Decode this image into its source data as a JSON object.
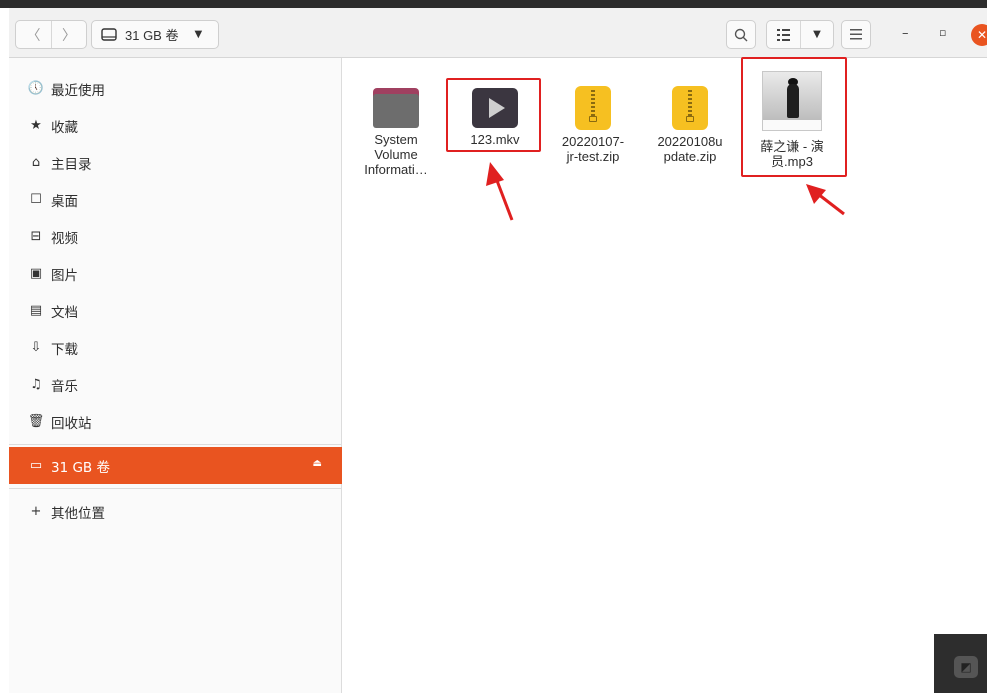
{
  "window": {
    "path_label": "31 GB 卷",
    "nav": {
      "back": "〈",
      "forward": "〉"
    }
  },
  "sidebar": {
    "items": [
      {
        "icon": "clock-icon",
        "glyph": "🕔",
        "label": "最近使用"
      },
      {
        "icon": "star-icon",
        "glyph": "★",
        "label": "收藏"
      },
      {
        "icon": "home-icon",
        "glyph": "⌂",
        "label": "主目录"
      },
      {
        "icon": "desktop-icon",
        "glyph": "☐",
        "label": "桌面"
      },
      {
        "icon": "video-icon",
        "glyph": "⊟",
        "label": "视频"
      },
      {
        "icon": "picture-icon",
        "glyph": "▣",
        "label": "图片"
      },
      {
        "icon": "document-icon",
        "glyph": "▤",
        "label": "文档"
      },
      {
        "icon": "download-icon",
        "glyph": "⇩",
        "label": "下载"
      },
      {
        "icon": "music-icon",
        "glyph": "♫",
        "label": "音乐"
      },
      {
        "icon": "trash-icon",
        "glyph": "🗑",
        "label": "回收站"
      }
    ],
    "volume": {
      "icon": "drive-icon",
      "glyph": "▭",
      "label": "31 GB 卷",
      "eject_icon": "eject-icon",
      "eject": "⏏"
    },
    "other": {
      "icon": "plus-icon",
      "glyph": "+",
      "label": "其他位置"
    },
    "active_color": "#e95420"
  },
  "files": [
    {
      "type": "folder",
      "icon": "folder-icon",
      "name_lines": [
        "System",
        "Volume",
        "Informati…"
      ]
    },
    {
      "type": "video",
      "icon": "video-file-icon",
      "name_lines": [
        "123.mkv"
      ]
    },
    {
      "type": "zip",
      "icon": "zip-file-icon",
      "name_lines": [
        "20220107-",
        "jr-test.zip"
      ]
    },
    {
      "type": "zip",
      "icon": "zip-file-icon",
      "name_lines": [
        "20220108u",
        "pdate.zip"
      ]
    },
    {
      "type": "audio",
      "icon": "album-art-thumbnail",
      "name_lines": [
        "薛之谦 - 演",
        "员.mp3"
      ]
    }
  ],
  "annotation_color": "#e02020"
}
